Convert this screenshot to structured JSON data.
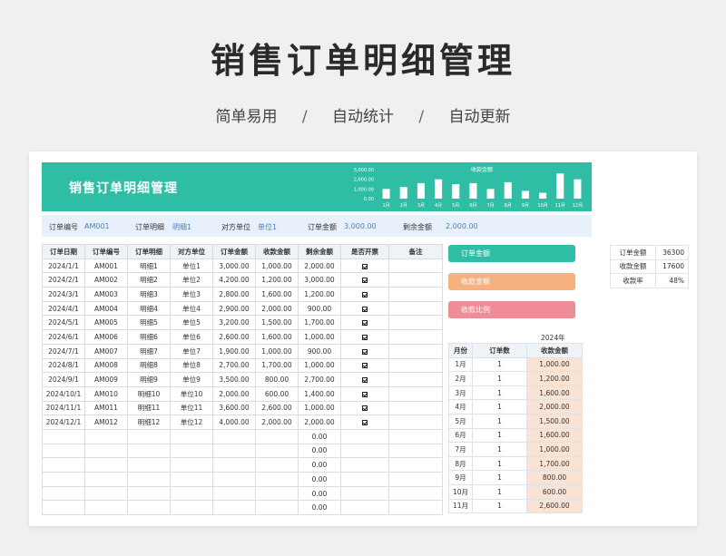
{
  "hero": {
    "title": "销售订单明细管理",
    "tags": [
      "简单易用",
      "自动统计",
      "自动更新"
    ],
    "separator": "/"
  },
  "banner": {
    "title": "销售订单明细管理"
  },
  "chart_data": {
    "type": "bar",
    "title": "收款金额",
    "categories": [
      "1月",
      "2月",
      "3月",
      "4月",
      "5月",
      "6月",
      "7月",
      "8月",
      "9月",
      "10月",
      "11月",
      "12月"
    ],
    "values": [
      1000,
      1200,
      1600,
      2000,
      1500,
      1600,
      1000,
      1700,
      800,
      600,
      2600,
      2000
    ],
    "ylim": [
      0,
      3000
    ],
    "yticks": [
      "3,000.00",
      "2,000.00",
      "1,000.00",
      "0.00"
    ],
    "bar_color": "#ffffff"
  },
  "info": {
    "order_no_label": "订单编号",
    "order_no": "AM001",
    "detail_label": "订单明细",
    "detail": "明细1",
    "party_label": "对方单位",
    "party": "单位1",
    "amount_label": "订单金额",
    "amount": "3,000.00",
    "remain_label": "剩余金额",
    "remain": "2,000.00"
  },
  "table": {
    "headers": [
      "订单日期",
      "订单编号",
      "订单明细",
      "对方单位",
      "订单金额",
      "收款金额",
      "剩余金额",
      "是否开票",
      "备注"
    ],
    "rows": [
      [
        "2024/1/1",
        "AM001",
        "明细1",
        "单位1",
        "3,000.00",
        "1,000.00",
        "2,000.00"
      ],
      [
        "2024/2/1",
        "AM002",
        "明细2",
        "单位2",
        "4,200.00",
        "1,200.00",
        "3,000.00"
      ],
      [
        "2024/3/1",
        "AM003",
        "明细3",
        "单位3",
        "2,800.00",
        "1,600.00",
        "1,200.00"
      ],
      [
        "2024/4/1",
        "AM004",
        "明细4",
        "单位4",
        "2,900.00",
        "2,000.00",
        "900.00"
      ],
      [
        "2024/5/1",
        "AM005",
        "明细5",
        "单位5",
        "3,200.00",
        "1,500.00",
        "1,700.00"
      ],
      [
        "2024/6/1",
        "AM006",
        "明细6",
        "单位6",
        "2,600.00",
        "1,600.00",
        "1,000.00"
      ],
      [
        "2024/7/1",
        "AM007",
        "明细7",
        "单位7",
        "1,900.00",
        "1,000.00",
        "900.00"
      ],
      [
        "2024/8/1",
        "AM008",
        "明细8",
        "单位8",
        "2,700.00",
        "1,700.00",
        "1,000.00"
      ],
      [
        "2024/9/1",
        "AM009",
        "明细9",
        "单位9",
        "3,500.00",
        "800.00",
        "2,700.00"
      ],
      [
        "2024/10/1",
        "AM010",
        "明细10",
        "单位10",
        "2,000.00",
        "600.00",
        "1,400.00"
      ],
      [
        "2024/11/1",
        "AM011",
        "明细11",
        "单位11",
        "3,600.00",
        "2,600.00",
        "1,000.00"
      ],
      [
        "2024/12/1",
        "AM012",
        "明细12",
        "单位12",
        "4,000.00",
        "2,000.00",
        "2,000.00"
      ]
    ],
    "empty_remaining": "0.00",
    "empty_rows": 6
  },
  "buttons": [
    {
      "label": "订单金额",
      "color": "#2fbda6"
    },
    {
      "label": "收款金额",
      "color": "#f5b27e"
    },
    {
      "label": "收款比例",
      "color": "#ee8d95"
    }
  ],
  "monthly": {
    "year": "2024年",
    "headers": [
      "月份",
      "订单数",
      "收款金额"
    ],
    "rows": [
      [
        "1月",
        "1",
        "1,000.00"
      ],
      [
        "2月",
        "1",
        "1,200.00"
      ],
      [
        "3月",
        "1",
        "1,600.00"
      ],
      [
        "4月",
        "1",
        "2,000.00"
      ],
      [
        "5月",
        "1",
        "1,500.00"
      ],
      [
        "6月",
        "1",
        "1,600.00"
      ],
      [
        "7月",
        "1",
        "1,000.00"
      ],
      [
        "8月",
        "1",
        "1,700.00"
      ],
      [
        "9月",
        "1",
        "800.00"
      ],
      [
        "10月",
        "1",
        "600.00"
      ],
      [
        "11月",
        "1",
        "2,600.00"
      ]
    ]
  },
  "summary": [
    {
      "label": "订单金额",
      "value": "36300"
    },
    {
      "label": "收款金额",
      "value": "17600"
    },
    {
      "label": "收款率",
      "value": "48%"
    }
  ]
}
